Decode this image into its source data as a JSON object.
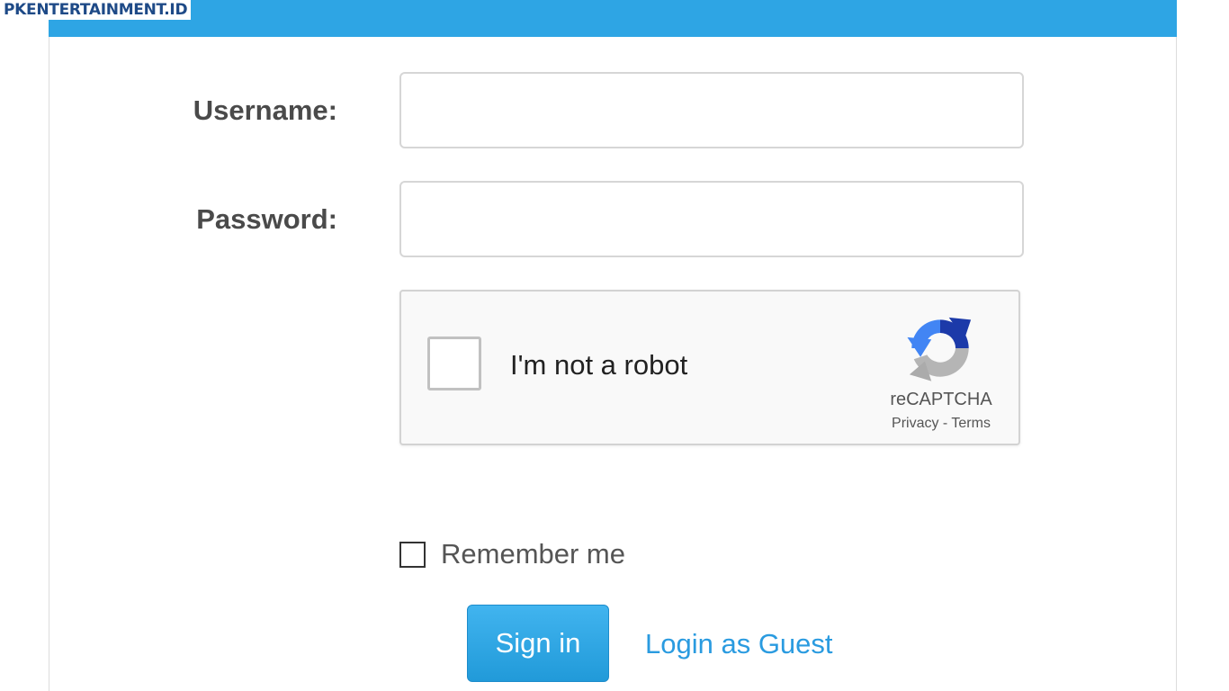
{
  "watermark": "PKENTERTAINMENT.ID",
  "form": {
    "username_label": "Username:",
    "username_value": "",
    "password_label": "Password:",
    "password_value": "",
    "recaptcha": {
      "checkbox_label": "I'm not a robot",
      "checked": false,
      "brand": "reCAPTCHA",
      "privacy": "Privacy",
      "separator": " - ",
      "terms": "Terms"
    },
    "remember_label": "Remember me",
    "remember_checked": false,
    "signin_label": "Sign in",
    "guest_label": "Login as Guest"
  },
  "colors": {
    "topbar": "#2ea5e4",
    "button": "#2aa4e6",
    "link": "#2a9be0"
  }
}
